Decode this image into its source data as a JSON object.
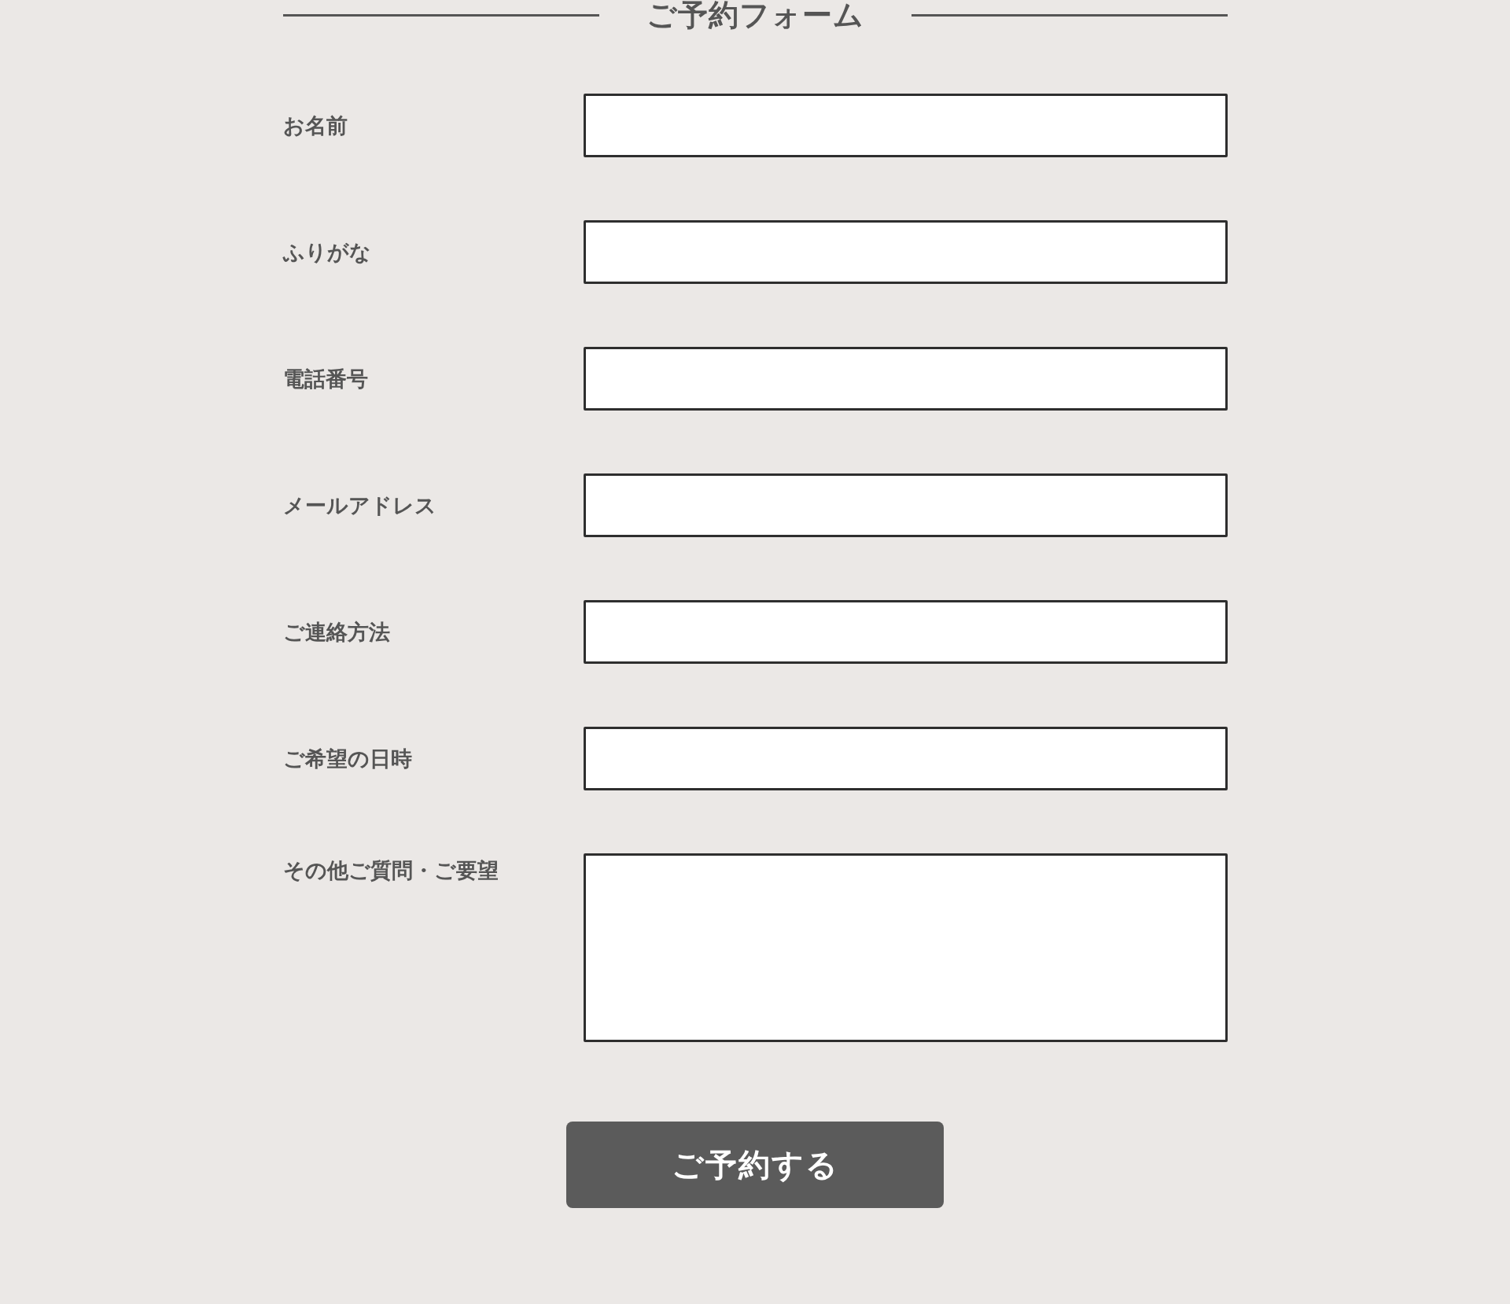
{
  "form": {
    "title": "ご予約フォーム",
    "fields": [
      {
        "label": "お名前",
        "kind": "text"
      },
      {
        "label": "ふりがな",
        "kind": "text"
      },
      {
        "label": "電話番号",
        "kind": "text"
      },
      {
        "label": "メールアドレス",
        "kind": "text"
      },
      {
        "label": "ご連絡方法",
        "kind": "text"
      },
      {
        "label": "ご希望の日時",
        "kind": "text"
      },
      {
        "label": "その他ご質問・ご要望",
        "kind": "textarea"
      }
    ],
    "submit_button": "ご予約する"
  }
}
